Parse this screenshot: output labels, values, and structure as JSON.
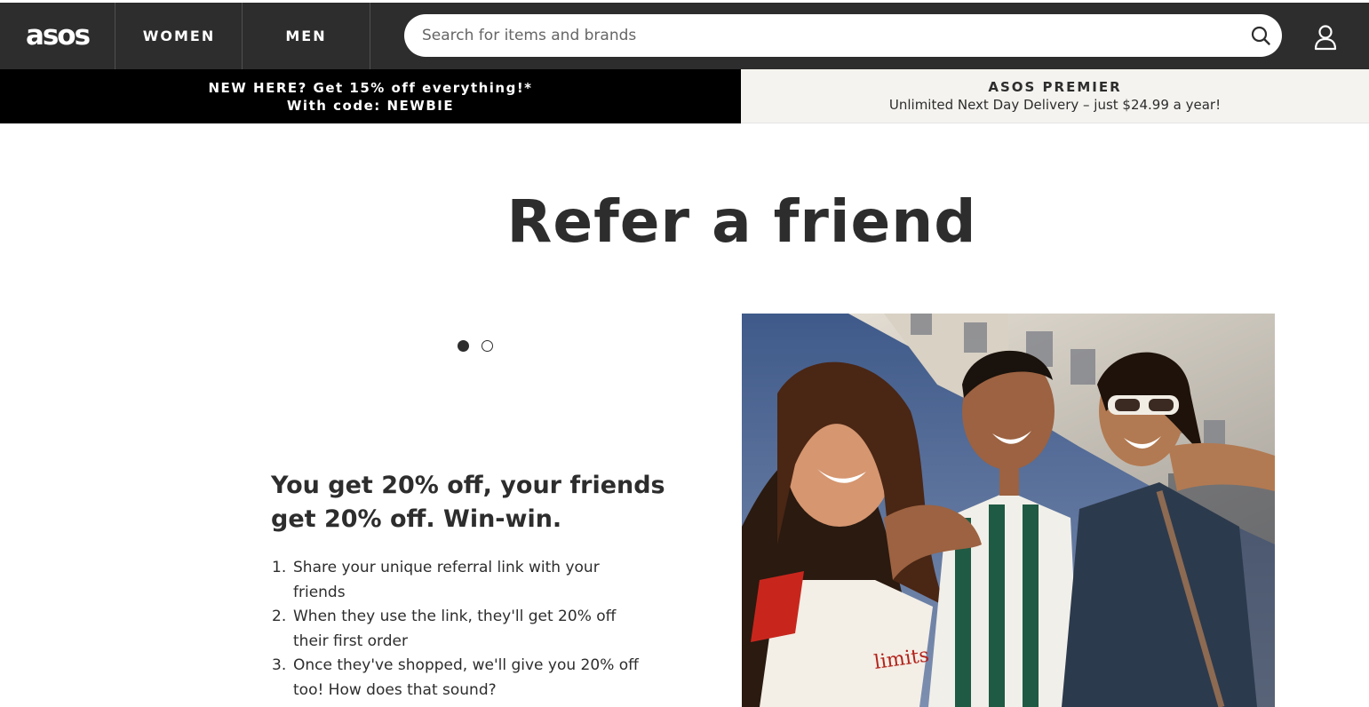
{
  "header": {
    "logo": "asos",
    "nav": [
      {
        "label": "WOMEN"
      },
      {
        "label": "MEN"
      }
    ],
    "search": {
      "placeholder": "Search for items and brands",
      "value": "",
      "icon": "search-icon"
    },
    "account_icon": "account-icon"
  },
  "promo_banner": {
    "left_line1": "NEW HERE? Get 15% off everything!*",
    "left_line2": "With code: NEWBIE",
    "right_title": "ASOS PREMIER",
    "right_subtitle": "Unlimited Next Day Delivery – just $24.99 a year!"
  },
  "main": {
    "title": "Refer a friend",
    "carousel": {
      "slide_count": 2,
      "active_index": 0
    },
    "headline": "You get 20% off, your friends get 20% off. Win-win.",
    "steps": [
      {
        "num": "1.",
        "text": "Share your unique referral link with your friends"
      },
      {
        "num": "2.",
        "text": "When they use the link, they'll get 20% off their first order"
      },
      {
        "num": "3.",
        "text": "Once they've shopped, we'll give you 20% off too! How does that sound?"
      }
    ],
    "image_shirt_text": "limits"
  },
  "colors": {
    "header_bg": "#2d2d2d",
    "promo_left_bg": "#000000",
    "promo_right_bg": "#f4f3ef",
    "text": "#2d2d2d"
  }
}
